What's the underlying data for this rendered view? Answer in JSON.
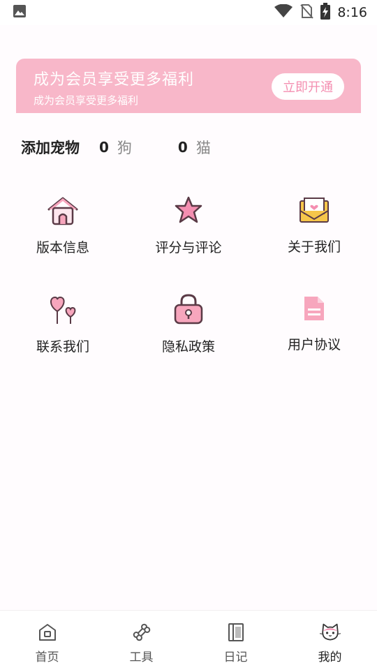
{
  "status_bar": {
    "time": "8:16",
    "icons": [
      "image-icon",
      "wifi-icon",
      "no-sim-icon",
      "battery-charging-icon"
    ]
  },
  "banner": {
    "title": "成为会员享受更多福利",
    "subtitle": "成为会员享受更多福利",
    "button_label": "立即开通",
    "color": "#f8b7c9"
  },
  "pets": {
    "title": "添加宠物",
    "dog_count": "0",
    "dog_label": "狗",
    "cat_count": "0",
    "cat_label": "猫"
  },
  "menu": [
    {
      "label": "版本信息",
      "icon": "house-icon"
    },
    {
      "label": "评分与评论",
      "icon": "star-icon"
    },
    {
      "label": "关于我们",
      "icon": "envelope-icon"
    },
    {
      "label": "联系我们",
      "icon": "hearts-icon"
    },
    {
      "label": "隐私政策",
      "icon": "lock-icon"
    },
    {
      "label": "用户协议",
      "icon": "document-icon"
    }
  ],
  "bottom_nav": [
    {
      "label": "首页",
      "icon": "home-icon"
    },
    {
      "label": "工具",
      "icon": "bone-icon"
    },
    {
      "label": "日记",
      "icon": "notebook-icon"
    },
    {
      "label": "我的",
      "icon": "cat-face-icon",
      "active": true
    }
  ],
  "colors": {
    "accent": "#f48fb1",
    "icon_outline": "#5a3a46"
  }
}
